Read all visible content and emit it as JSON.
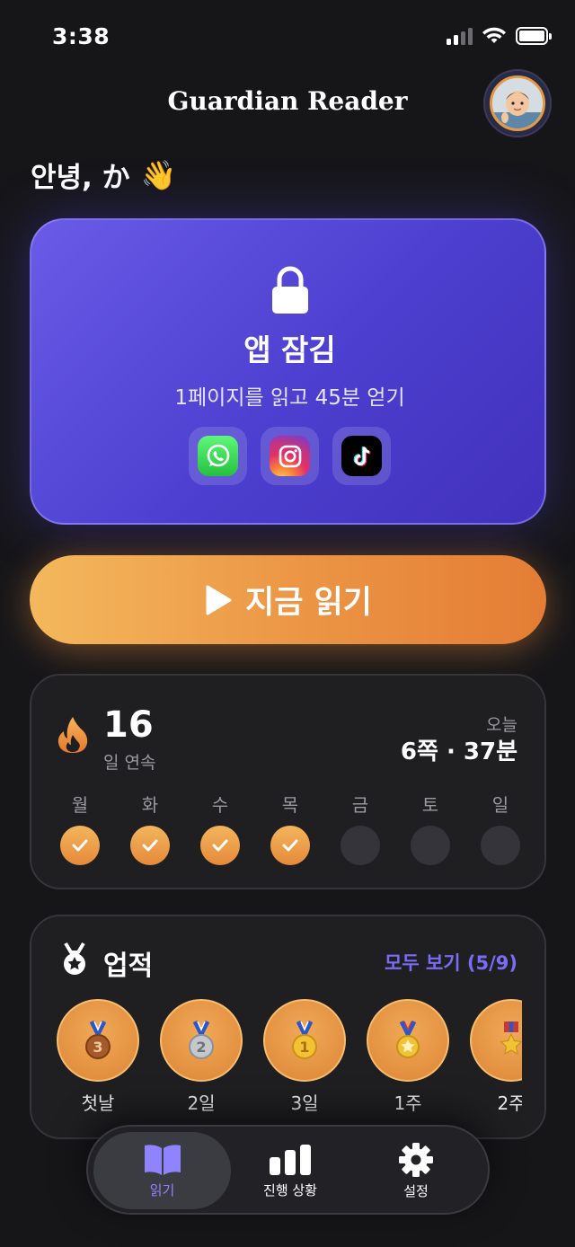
{
  "status": {
    "time": "3:38"
  },
  "header": {
    "title": "Guardian Reader"
  },
  "greeting": {
    "text": "안녕, か",
    "emoji": "👋"
  },
  "lock_card": {
    "title": "앱 잠김",
    "subtitle": "1페이지를 읽고 45분 얻기",
    "apps": [
      "whatsapp-icon",
      "instagram-icon",
      "tiktok-icon"
    ]
  },
  "read_button": {
    "label": "지금 읽기"
  },
  "streak": {
    "count": "16",
    "label": "일 연속",
    "today_label": "오늘",
    "today_value": "6쪽 · 37분",
    "days": [
      {
        "name": "월",
        "done": true
      },
      {
        "name": "화",
        "done": true
      },
      {
        "name": "수",
        "done": true
      },
      {
        "name": "목",
        "done": true
      },
      {
        "name": "금",
        "done": false
      },
      {
        "name": "토",
        "done": false
      },
      {
        "name": "일",
        "done": false
      }
    ]
  },
  "achievements": {
    "title": "업적",
    "view_all": "모두 보기 (5/9)",
    "badges": [
      {
        "label": "첫날",
        "medal": "3"
      },
      {
        "label": "2일",
        "medal": "2"
      },
      {
        "label": "3일",
        "medal": "1"
      },
      {
        "label": "1주",
        "medal": "star"
      },
      {
        "label": "2주",
        "medal": "military"
      }
    ]
  },
  "tabbar": {
    "tabs": [
      {
        "label": "읽기",
        "icon": "book-icon",
        "active": true
      },
      {
        "label": "진행 상황",
        "icon": "bar-chart-icon",
        "active": false
      },
      {
        "label": "설정",
        "icon": "gear-icon",
        "active": false
      }
    ]
  },
  "colors": {
    "accent": "#8f83ff",
    "orange": "#eb9444",
    "card": "#1f1f22",
    "lock_card": "#5a4be0"
  }
}
